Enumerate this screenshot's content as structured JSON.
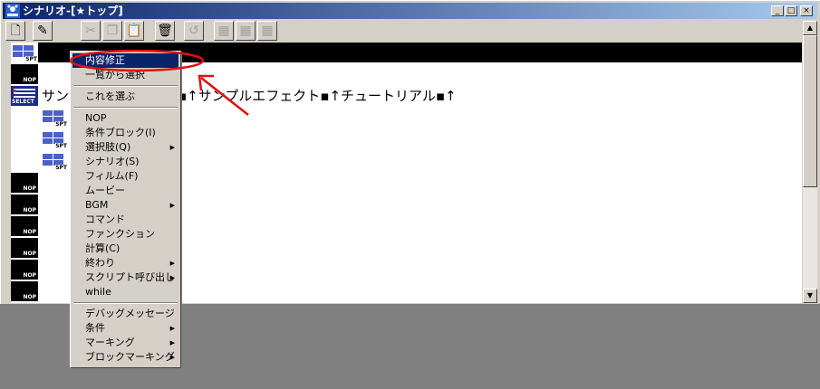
{
  "window": {
    "title": "シナリオ-[★トップ]",
    "controls": [
      "_",
      "□",
      "×"
    ]
  },
  "toolbar": {
    "buttons": [
      {
        "name": "new-document-button",
        "icon": "new-page-icon",
        "glyph": "🗋",
        "enabled": true
      },
      {
        "name": "edit-pencil-button",
        "icon": "pencil-icon",
        "glyph": "✎",
        "enabled": true
      },
      {
        "name": "cut-button",
        "icon": "scissors-icon",
        "glyph": "✂",
        "enabled": false
      },
      {
        "name": "copy-button",
        "icon": "copy-icon",
        "glyph": "❐",
        "enabled": false
      },
      {
        "name": "paste-button",
        "icon": "paste-icon",
        "glyph": "📋",
        "enabled": false
      },
      {
        "name": "delete-button",
        "icon": "trash-icon",
        "glyph": "🗑",
        "enabled": true
      },
      {
        "name": "undo-button",
        "icon": "undo-icon",
        "glyph": "↺",
        "enabled": false
      },
      {
        "name": "tool-button-1",
        "icon": "grid-icon",
        "glyph": "▦",
        "enabled": false
      },
      {
        "name": "tool-button-2",
        "icon": "grid-icon",
        "glyph": "▦",
        "enabled": false
      },
      {
        "name": "tool-button-3",
        "icon": "grid-icon",
        "glyph": "▦",
        "enabled": false
      }
    ]
  },
  "content": {
    "icon_labels": {
      "nop": "NOP",
      "spt": "SPT",
      "select": "SELECT"
    },
    "scenario_text": "サン　　　　　　　）▪↑サンプルエフェクト▪↑チュートリアル▪↑"
  },
  "context_menu": {
    "items": [
      {
        "label": "内容修正",
        "highlighted": true,
        "submenu": false
      },
      {
        "label": "一覧から選択",
        "highlighted": false,
        "submenu": false
      },
      {
        "separator": true
      },
      {
        "label": "これを選ぶ",
        "highlighted": false,
        "submenu": false
      },
      {
        "separator": true
      },
      {
        "label": "NOP",
        "highlighted": false,
        "submenu": false
      },
      {
        "label": "条件ブロック(I)",
        "highlighted": false,
        "submenu": false
      },
      {
        "label": "選択肢(Q)",
        "highlighted": false,
        "submenu": true
      },
      {
        "label": "シナリオ(S)",
        "highlighted": false,
        "submenu": false
      },
      {
        "label": "フィルム(F)",
        "highlighted": false,
        "submenu": false
      },
      {
        "label": "ムービー",
        "highlighted": false,
        "submenu": false
      },
      {
        "label": "BGM",
        "highlighted": false,
        "submenu": true
      },
      {
        "label": "コマンド",
        "highlighted": false,
        "submenu": false
      },
      {
        "label": "ファンクション",
        "highlighted": false,
        "submenu": false
      },
      {
        "label": "計算(C)",
        "highlighted": false,
        "submenu": false
      },
      {
        "label": "終わり",
        "highlighted": false,
        "submenu": true
      },
      {
        "label": "スクリプト呼び出し",
        "highlighted": false,
        "submenu": true
      },
      {
        "label": "while",
        "highlighted": false,
        "submenu": false
      },
      {
        "separator": true
      },
      {
        "label": "デバッグメッセージ",
        "highlighted": false,
        "submenu": false
      },
      {
        "label": "条件",
        "highlighted": false,
        "submenu": true
      },
      {
        "label": "マーキング",
        "highlighted": false,
        "submenu": true
      },
      {
        "label": "ブロックマーキング",
        "highlighted": false,
        "submenu": true
      }
    ]
  },
  "annotation": {
    "color": "#e01010"
  },
  "colors": {
    "title_start": "#0a246a",
    "title_end": "#a6caf0",
    "highlight": "#0a246a"
  }
}
